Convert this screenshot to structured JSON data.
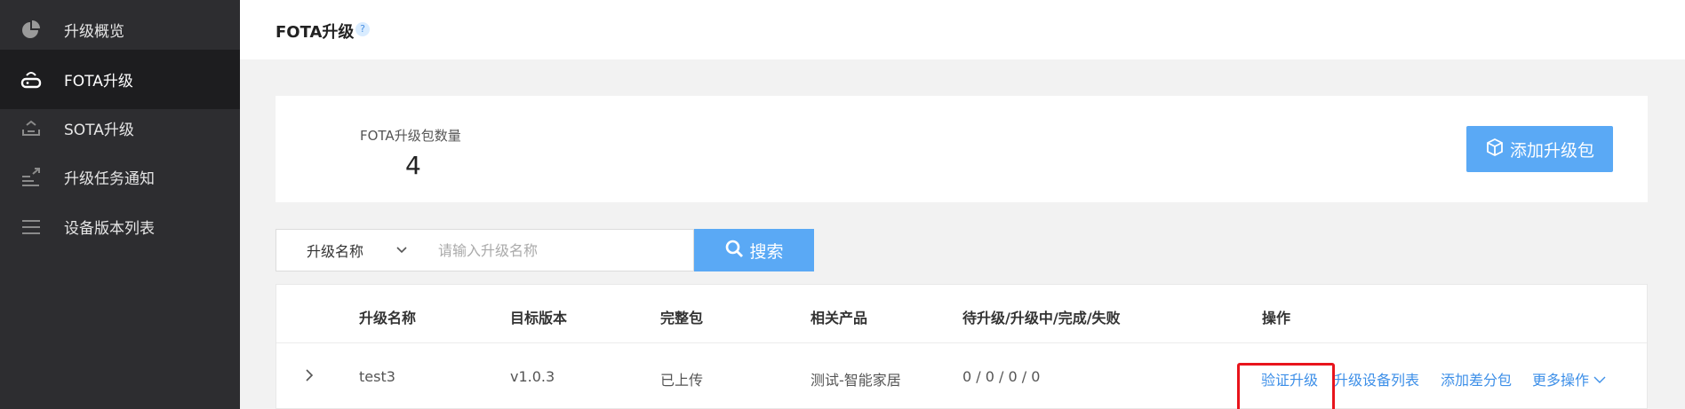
{
  "sidebar": {
    "items": [
      {
        "label": "升级概览",
        "icon": "pie-chart-icon",
        "active": false
      },
      {
        "label": "FOTA升级",
        "icon": "router-icon",
        "active": true
      },
      {
        "label": "SOTA升级",
        "icon": "upload-tray-icon",
        "active": false
      },
      {
        "label": "升级任务通知",
        "icon": "task-notify-icon",
        "active": false
      },
      {
        "label": "设备版本列表",
        "icon": "list-icon",
        "active": false
      }
    ]
  },
  "header": {
    "title": "FOTA升级",
    "help_icon": "question-icon"
  },
  "stats": {
    "label": "FOTA升级包数量",
    "value": "4"
  },
  "actions": {
    "add_package_label": "添加升级包",
    "add_icon": "package-box-icon"
  },
  "search": {
    "select_value": "升级名称",
    "placeholder": "请输入升级名称",
    "button_label": "搜索"
  },
  "table": {
    "columns": [
      "升级名称",
      "目标版本",
      "完整包",
      "相关产品",
      "待升级/升级中/完成/失败",
      "操作"
    ],
    "rows": [
      {
        "name": "test3",
        "version": "v1.0.3",
        "package": "已上传",
        "product": "测试-智能家居",
        "progress": "0 / 0 / 0 / 0",
        "ops": [
          "验证升级",
          "升级设备列表",
          "添加差分包",
          "更多操作"
        ]
      }
    ]
  },
  "colors": {
    "accent": "#5aa9f5",
    "link": "#3d8fe8",
    "highlight": "#e8141c",
    "sidebar": "#2d2d30"
  }
}
